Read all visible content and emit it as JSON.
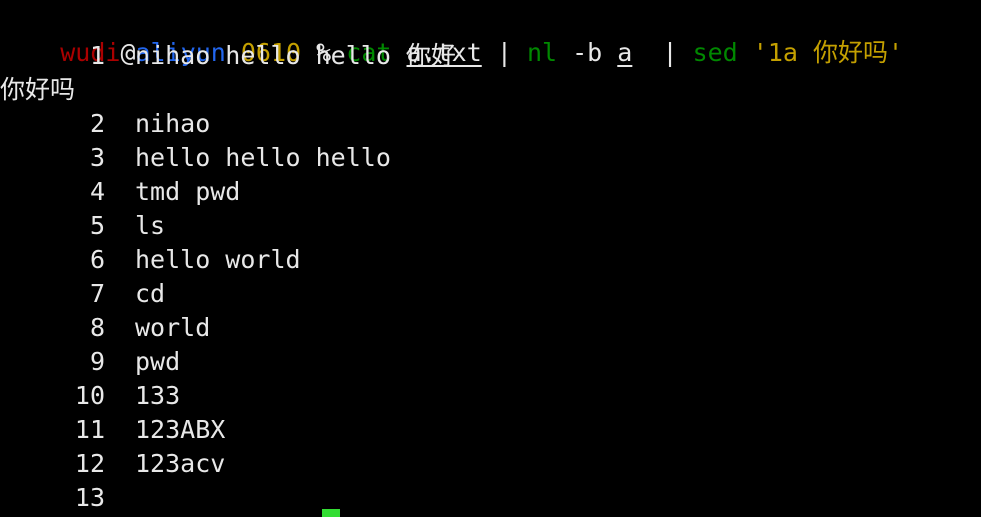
{
  "terminal": {
    "background_color": "#000000",
    "foreground_color": "#e8e8e8",
    "cursor_color": "#33dd33",
    "prompt": {
      "user": "wudi",
      "at": "@",
      "host": "aliyun",
      "dir": "0610",
      "symbol": "%",
      "user_color": "#aa0000",
      "host_color": "#2266ee",
      "dir_color": "#c4a000",
      "symbol_color": "#e8e8e8"
    },
    "command": {
      "full": "cat a.txt | nl -b a  | sed '1a 你好吗'",
      "tokens": [
        {
          "text": "cat",
          "color": "#008800",
          "underline": false
        },
        {
          "text": " ",
          "color": "#e8e8e8",
          "underline": false
        },
        {
          "text": "a.txt",
          "color": "#e8e8e8",
          "underline": true
        },
        {
          "text": " ",
          "color": "#e8e8e8",
          "underline": false
        },
        {
          "text": "|",
          "color": "#e8e8e8",
          "underline": false
        },
        {
          "text": " ",
          "color": "#e8e8e8",
          "underline": false
        },
        {
          "text": "nl",
          "color": "#008800",
          "underline": false
        },
        {
          "text": " -b ",
          "color": "#e8e8e8",
          "underline": false
        },
        {
          "text": "a",
          "color": "#e8e8e8",
          "underline": true
        },
        {
          "text": "  | ",
          "color": "#e8e8e8",
          "underline": false
        },
        {
          "text": "sed",
          "color": "#008800",
          "underline": false
        },
        {
          "text": " ",
          "color": "#e8e8e8",
          "underline": false
        },
        {
          "text": "'1a 你好吗'",
          "color": "#c4a000",
          "underline": false
        }
      ]
    },
    "output": {
      "rows": [
        {
          "number": "1",
          "text": "nihao hello hello 你好"
        },
        {
          "number": "",
          "text": "你好吗",
          "wrapped": true
        },
        {
          "number": "2",
          "text": "nihao"
        },
        {
          "number": "3",
          "text": "hello hello hello"
        },
        {
          "number": "4",
          "text": "tmd pwd"
        },
        {
          "number": "5",
          "text": "ls"
        },
        {
          "number": "6",
          "text": "hello world"
        },
        {
          "number": "7",
          "text": "cd"
        },
        {
          "number": "8",
          "text": "world"
        },
        {
          "number": "9",
          "text": "pwd"
        },
        {
          "number": "10",
          "text": "133"
        },
        {
          "number": "11",
          "text": "123ABX"
        },
        {
          "number": "12",
          "text": "123acv"
        },
        {
          "number": "13",
          "text": ""
        }
      ]
    }
  }
}
